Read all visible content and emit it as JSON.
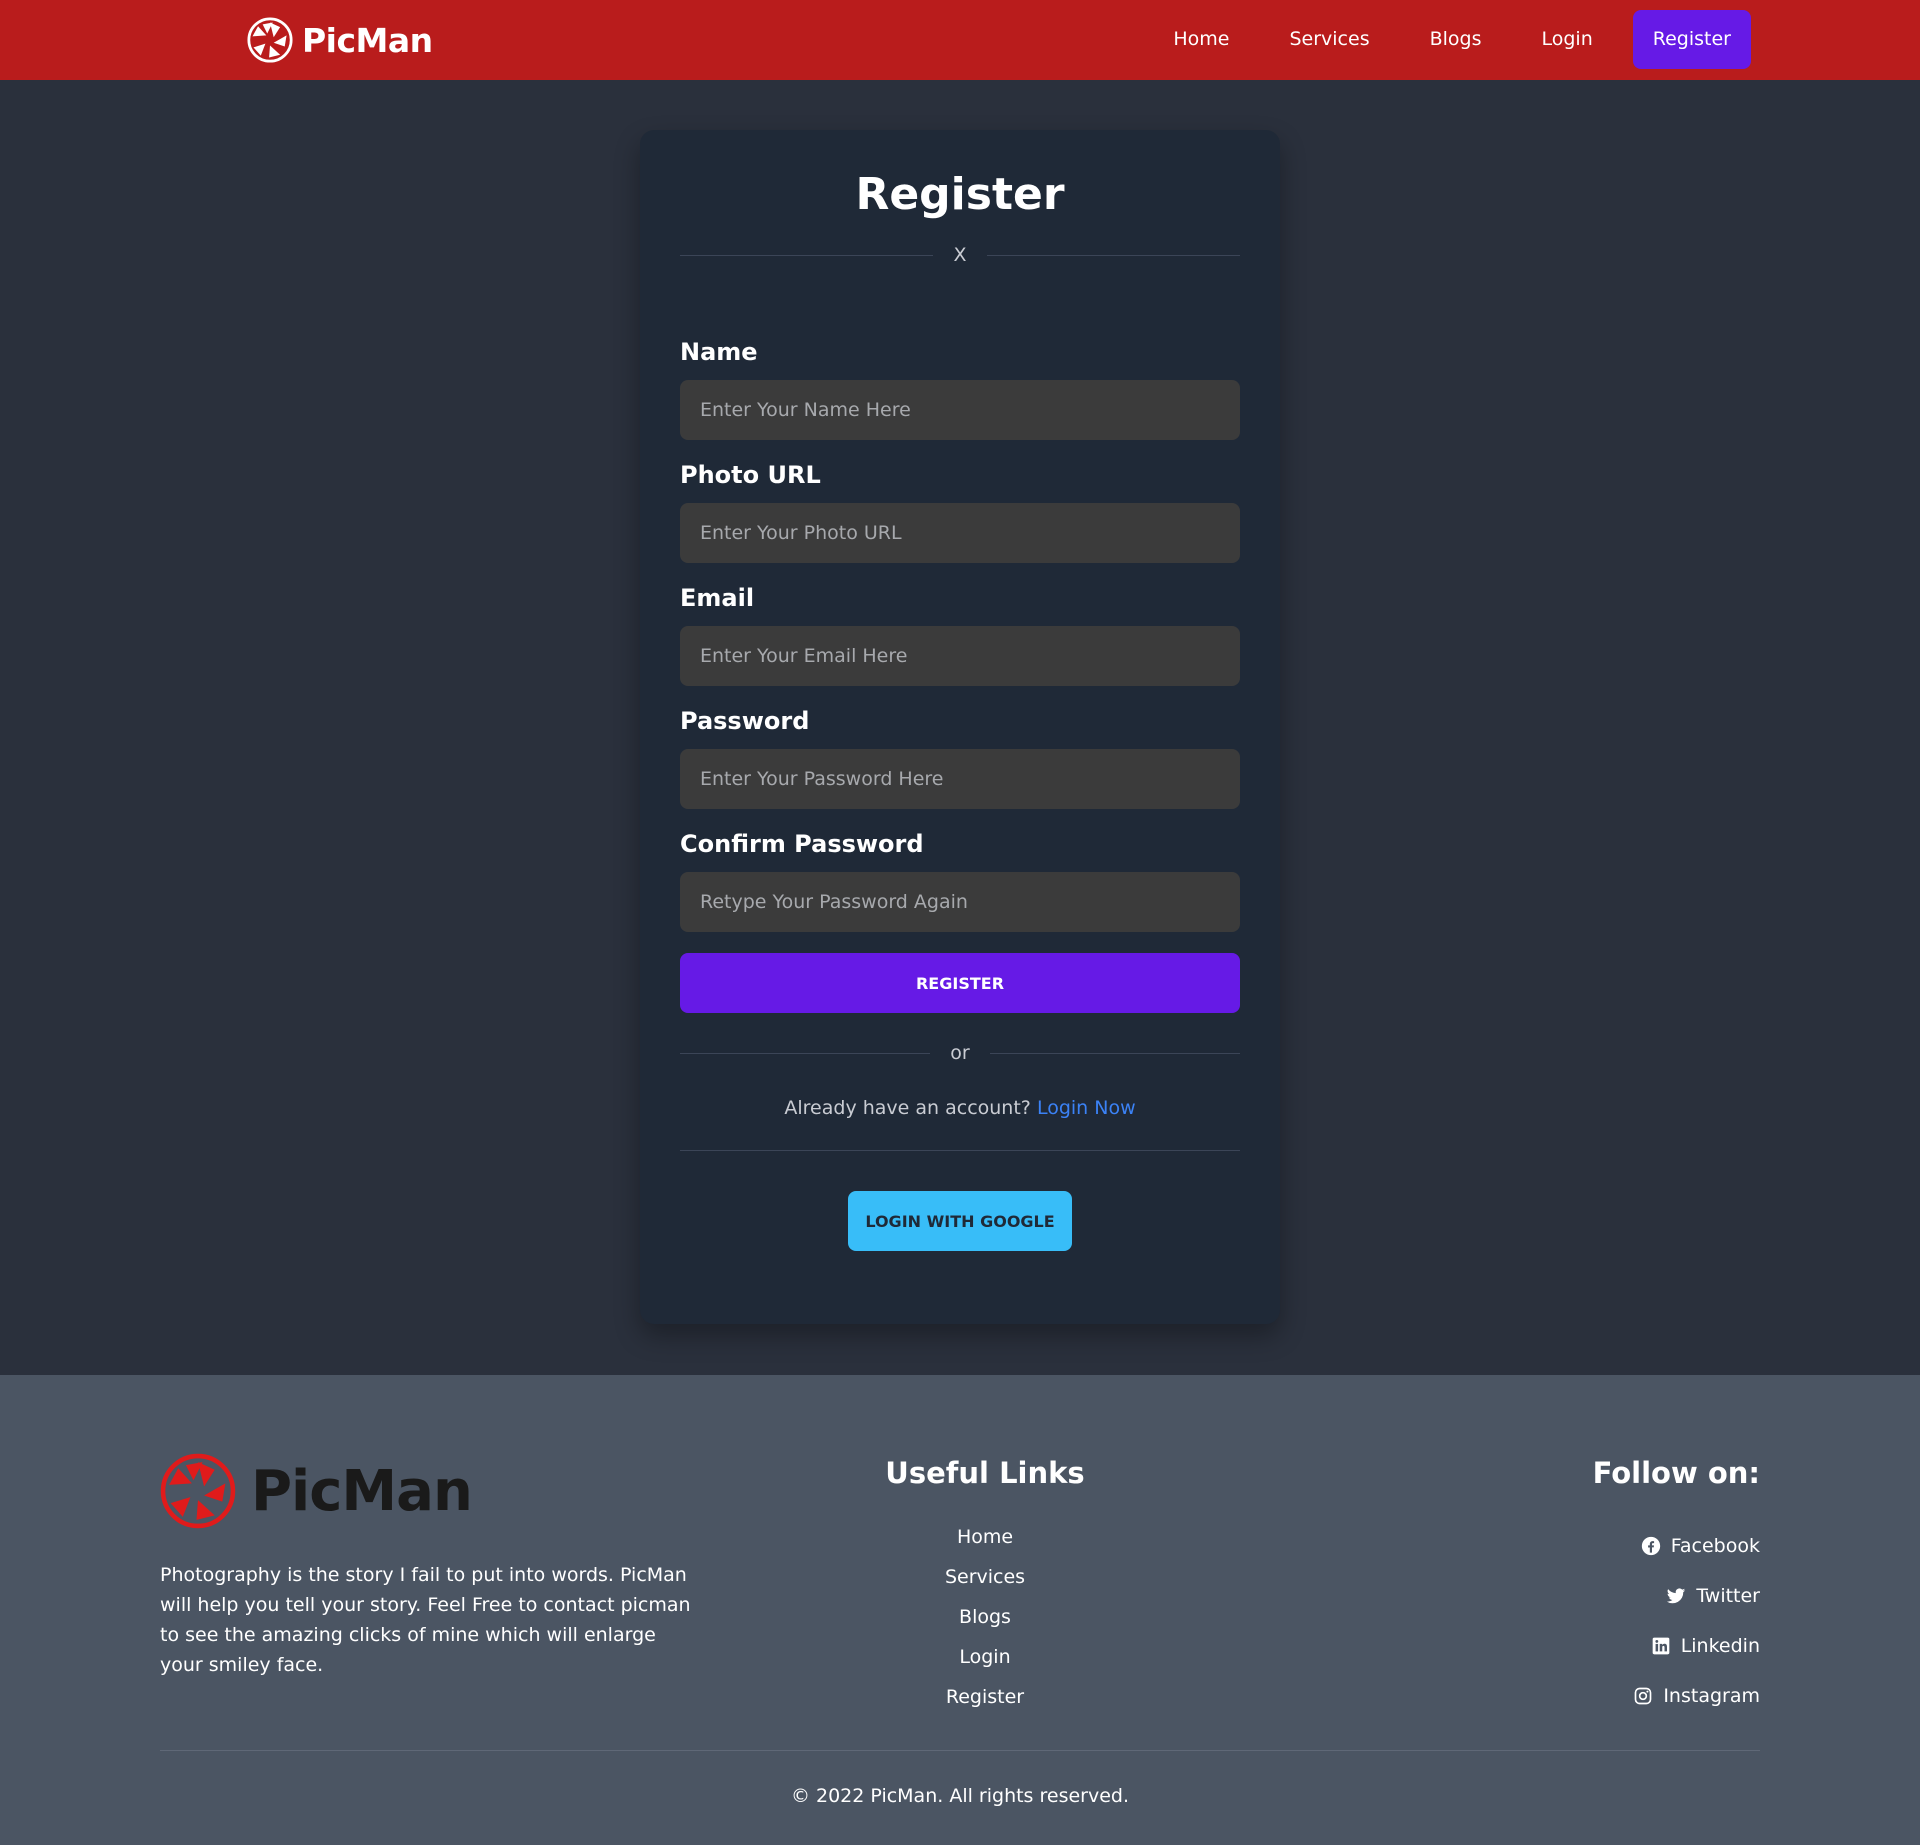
{
  "navbar": {
    "brand": "PicMan",
    "links": [
      "Home",
      "Services",
      "Blogs",
      "Login",
      "Register"
    ]
  },
  "card": {
    "title": "Register",
    "divider_mark": "X",
    "fields": [
      {
        "label": "Name",
        "placeholder": "Enter Your Name Here"
      },
      {
        "label": "Photo URL",
        "placeholder": "Enter Your Photo URL"
      },
      {
        "label": "Email",
        "placeholder": "Enter Your Email Here"
      },
      {
        "label": "Password",
        "placeholder": "Enter Your Password Here"
      },
      {
        "label": "Confirm Password",
        "placeholder": "Retype Your Password Again"
      }
    ],
    "submit_label": "REGISTER",
    "or_label": "or",
    "already_text": "Already have an account? ",
    "login_link": "Login Now",
    "google_label": "LOGIN WITH GOOGLE"
  },
  "footer": {
    "brand": "PicMan",
    "description": "Photography is the story I fail to put into words. PicMan will help you tell your story. Feel Free to contact picman to see the amazing clicks of mine which will enlarge your smiley face.",
    "useful_links_title": "Useful Links",
    "useful_links": [
      "Home",
      "Services",
      "Blogs",
      "Login",
      "Register"
    ],
    "follow_title": "Follow on:",
    "social": [
      {
        "label": "Facebook",
        "icon": "facebook-icon"
      },
      {
        "label": "Twitter",
        "icon": "twitter-icon"
      },
      {
        "label": "Linkedin",
        "icon": "linkedin-icon"
      },
      {
        "label": "Instagram",
        "icon": "instagram-icon"
      }
    ],
    "copyright": "© 2022 PicMan. All rights reserved."
  },
  "colors": {
    "navbar": "#b91c1c",
    "page_bg": "#2a303c",
    "card_bg": "#1f2937",
    "input_bg": "#3b3b3b",
    "primary": "#661ae6",
    "google": "#38bdf8",
    "link": "#3b82f6",
    "footer_bg": "#4b5563"
  }
}
